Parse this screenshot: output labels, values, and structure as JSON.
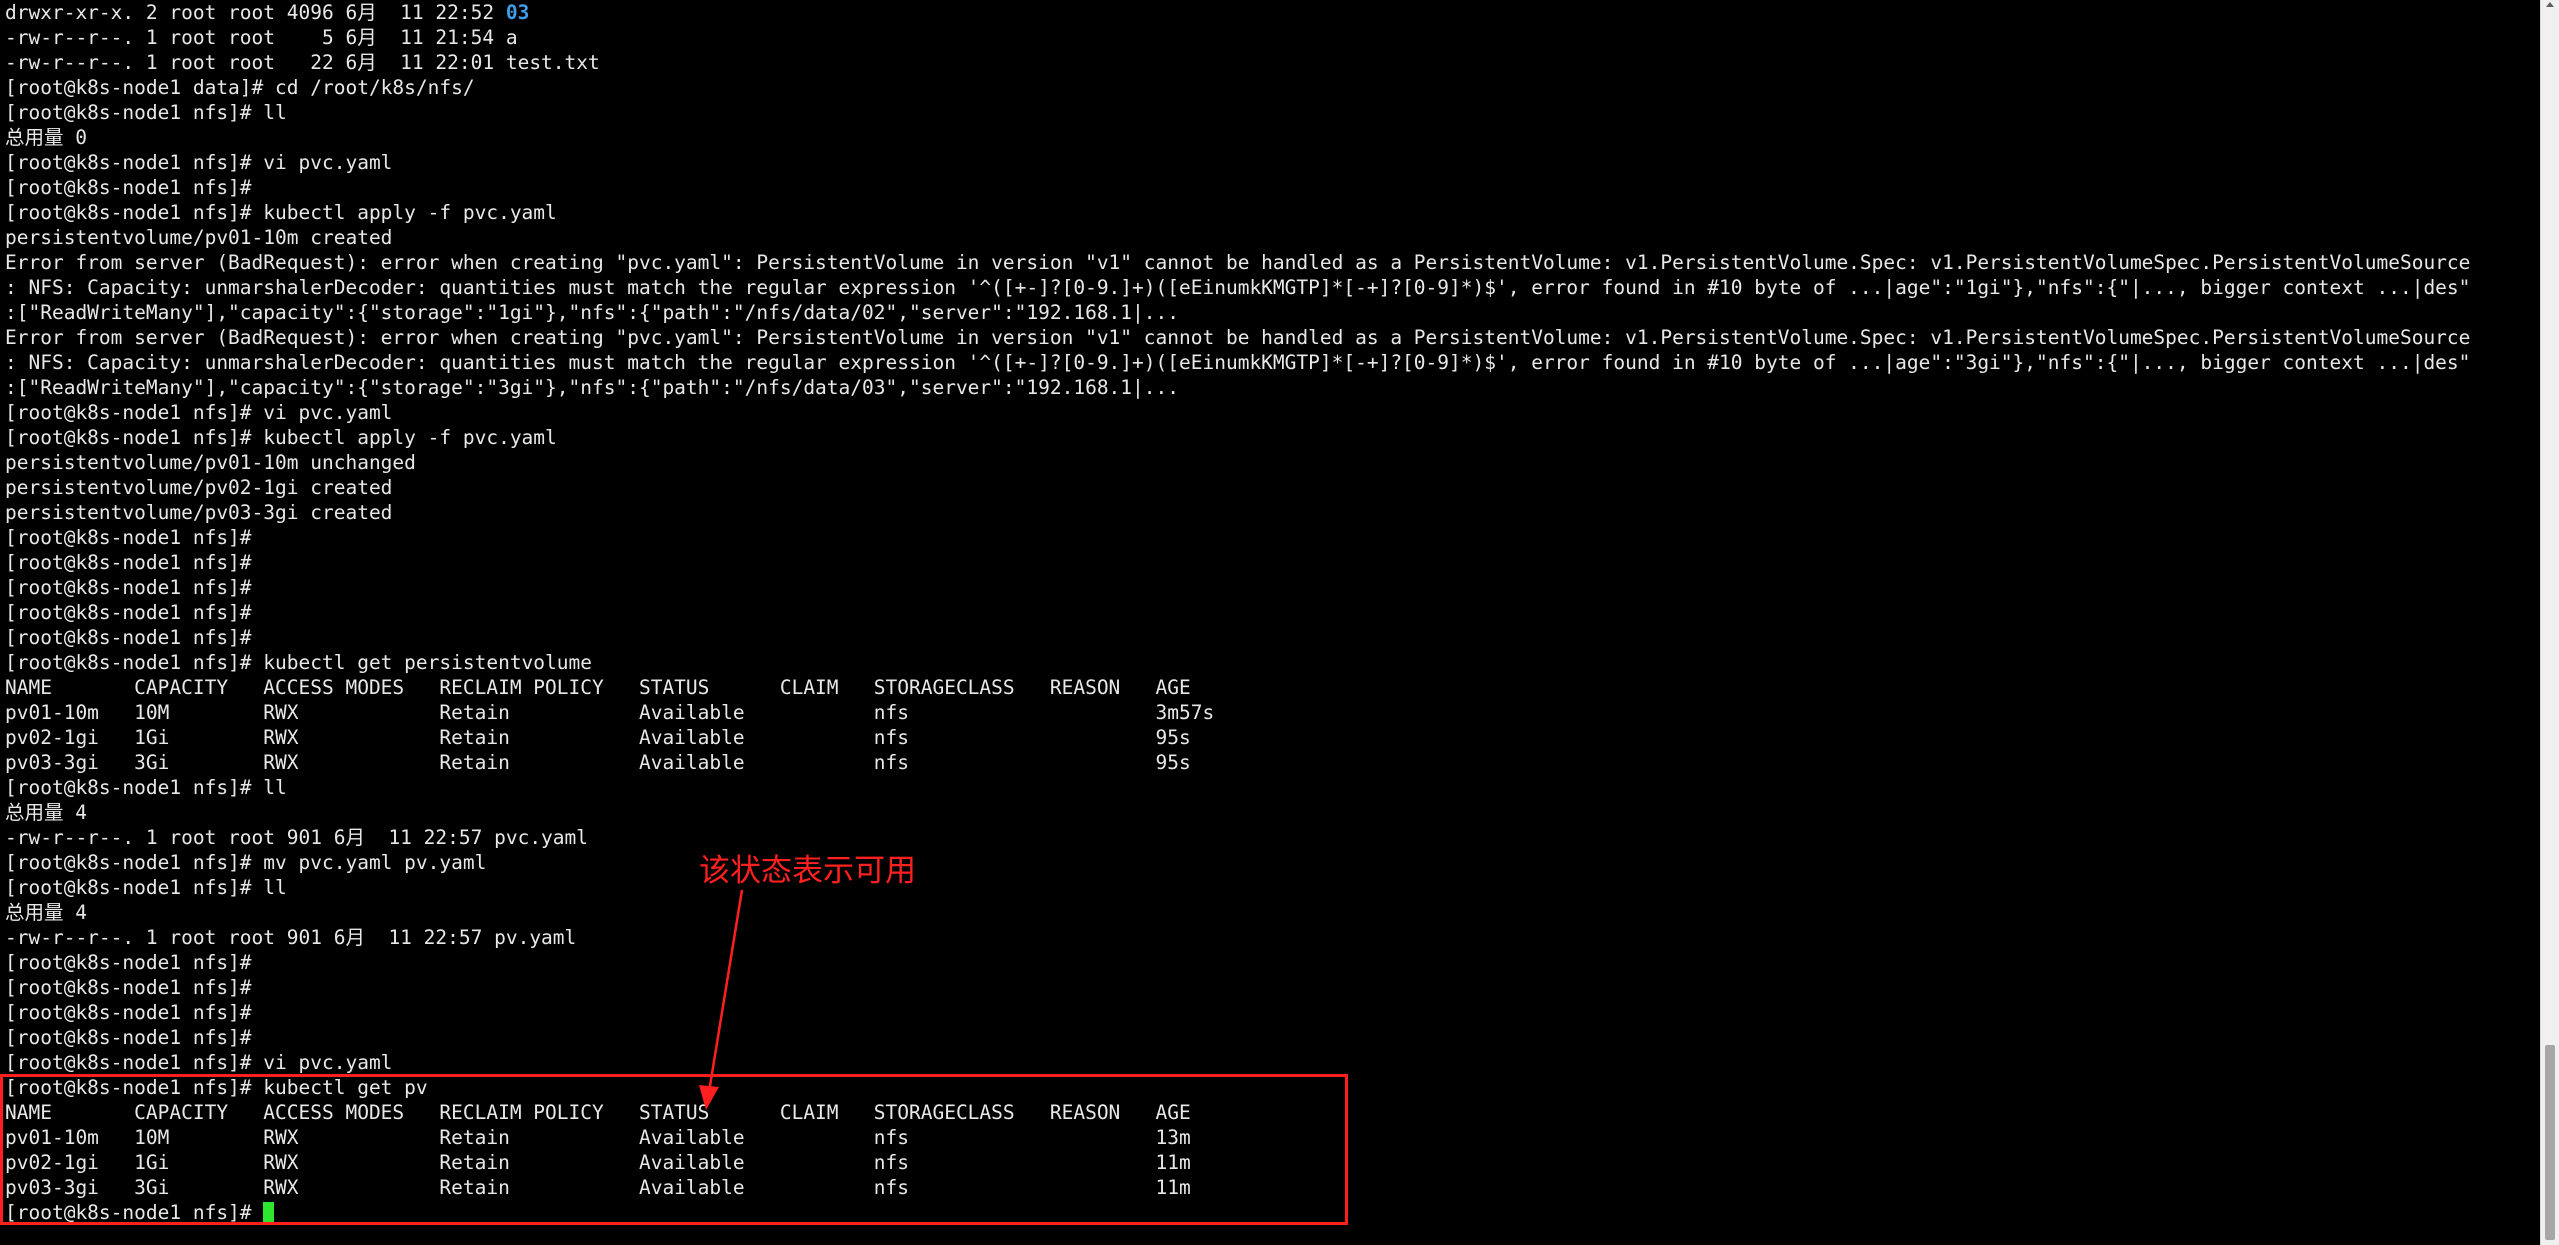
{
  "terminal": {
    "lines": [
      "drwxr-xr-x. 2 root root 4096 6月  11 22:52 ",
      "-rw-r--r--. 1 root root    5 6月  11 21:54 a",
      "-rw-r--r--. 1 root root   22 6月  11 22:01 test.txt",
      "[root@k8s-node1 data]# cd /root/k8s/nfs/",
      "[root@k8s-node1 nfs]# ll",
      "总用量 0",
      "[root@k8s-node1 nfs]# vi pvc.yaml",
      "[root@k8s-node1 nfs]#",
      "[root@k8s-node1 nfs]# kubectl apply -f pvc.yaml",
      "persistentvolume/pv01-10m created",
      "Error from server (BadRequest): error when creating \"pvc.yaml\": PersistentVolume in version \"v1\" cannot be handled as a PersistentVolume: v1.PersistentVolume.Spec: v1.PersistentVolumeSpec.PersistentVolumeSource",
      ": NFS: Capacity: unmarshalerDecoder: quantities must match the regular expression '^([+-]?[0-9.]+)([eEinumkKMGTP]*[-+]?[0-9]*)$', error found in #10 byte of ...|age\":\"1gi\"},\"nfs\":{\"|..., bigger context ...|des\"",
      ":[\"ReadWriteMany\"],\"capacity\":{\"storage\":\"1gi\"},\"nfs\":{\"path\":\"/nfs/data/02\",\"server\":\"192.168.1|...",
      "Error from server (BadRequest): error when creating \"pvc.yaml\": PersistentVolume in version \"v1\" cannot be handled as a PersistentVolume: v1.PersistentVolume.Spec: v1.PersistentVolumeSpec.PersistentVolumeSource",
      ": NFS: Capacity: unmarshalerDecoder: quantities must match the regular expression '^([+-]?[0-9.]+)([eEinumkKMGTP]*[-+]?[0-9]*)$', error found in #10 byte of ...|age\":\"3gi\"},\"nfs\":{\"|..., bigger context ...|des\"",
      ":[\"ReadWriteMany\"],\"capacity\":{\"storage\":\"3gi\"},\"nfs\":{\"path\":\"/nfs/data/03\",\"server\":\"192.168.1|...",
      "[root@k8s-node1 nfs]# vi pvc.yaml",
      "[root@k8s-node1 nfs]# kubectl apply -f pvc.yaml",
      "persistentvolume/pv01-10m unchanged",
      "persistentvolume/pv02-1gi created",
      "persistentvolume/pv03-3gi created",
      "[root@k8s-node1 nfs]#",
      "[root@k8s-node1 nfs]#",
      "[root@k8s-node1 nfs]#",
      "[root@k8s-node1 nfs]#",
      "[root@k8s-node1 nfs]#",
      "[root@k8s-node1 nfs]# kubectl get persistentvolume",
      "NAME       CAPACITY   ACCESS MODES   RECLAIM POLICY   STATUS      CLAIM   STORAGECLASS   REASON   AGE",
      "pv01-10m   10M        RWX            Retain           Available           nfs                     3m57s",
      "pv02-1gi   1Gi        RWX            Retain           Available           nfs                     95s",
      "pv03-3gi   3Gi        RWX            Retain           Available           nfs                     95s",
      "[root@k8s-node1 nfs]# ll",
      "总用量 4",
      "-rw-r--r--. 1 root root 901 6月  11 22:57 pvc.yaml",
      "[root@k8s-node1 nfs]# mv pvc.yaml pv.yaml",
      "[root@k8s-node1 nfs]# ll",
      "总用量 4",
      "-rw-r--r--. 1 root root 901 6月  11 22:57 pv.yaml",
      "[root@k8s-node1 nfs]#",
      "[root@k8s-node1 nfs]#",
      "[root@k8s-node1 nfs]#",
      "[root@k8s-node1 nfs]#",
      "[root@k8s-node1 nfs]# vi pvc.yaml",
      "[root@k8s-node1 nfs]# kubectl get pv",
      "NAME       CAPACITY   ACCESS MODES   RECLAIM POLICY   STATUS      CLAIM   STORAGECLASS   REASON   AGE",
      "pv01-10m   10M        RWX            Retain           Available           nfs                     13m",
      "pv02-1gi   1Gi        RWX            Retain           Available           nfs                     11m",
      "pv03-3gi   3Gi        RWX            Retain           Available           nfs                     11m",
      "[root@k8s-node1 nfs]# "
    ],
    "first_line_dir": "03"
  },
  "annotation": {
    "text": "该状态表示可用"
  },
  "colors": {
    "background": "#000000",
    "foreground": "#e8e8e8",
    "directory": "#3f9ee8",
    "cursor": "#2ee62e",
    "annotation": "#ff2020",
    "highlight_border": "#ff1f1f"
  },
  "icons": {
    "cursor": "block-cursor-icon",
    "arrow": "arrow-down-icon"
  }
}
